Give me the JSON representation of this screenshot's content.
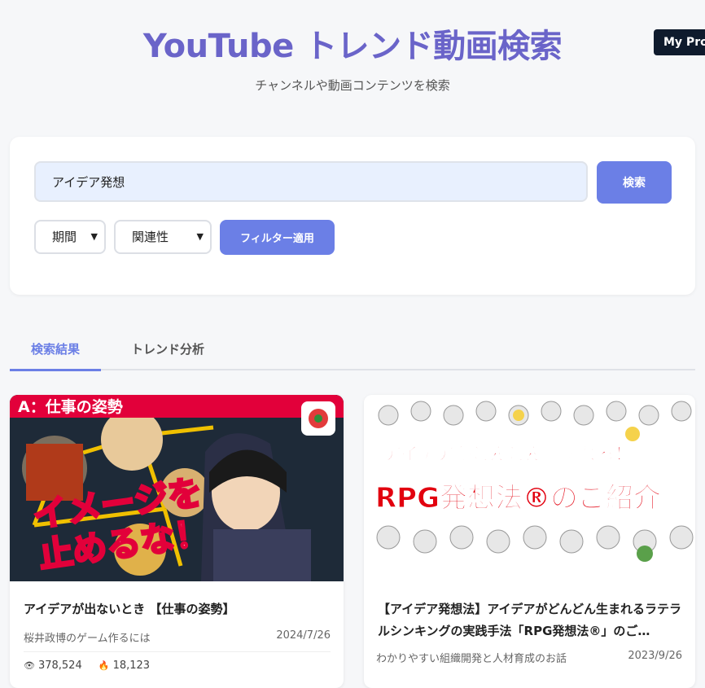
{
  "header": {
    "title": "YouTube トレンド動画検索",
    "subtitle": "チャンネルや動画コンテンツを検索",
    "profile_badge": "My Profile"
  },
  "search": {
    "query": "アイデア発想",
    "button_label": "検索",
    "period_select": "期間",
    "sort_select": "関連性",
    "filter_button": "フィルター適用"
  },
  "tabs": [
    {
      "label": "検索結果",
      "active": true
    },
    {
      "label": "トレンド分析",
      "active": false
    }
  ],
  "colors": {
    "accent": "#6b7fe6",
    "title": "#6a64c9"
  },
  "results": [
    {
      "thumbnail_text_top": "A：仕事の姿勢",
      "thumbnail_text_main": [
        "イメージを",
        "止めるな！"
      ],
      "title": "アイデアが出ないとき 【仕事の姿勢】",
      "channel": "桜井政博のゲーム作るには",
      "date": "2024/7/26",
      "views": "378,524",
      "likes": "18,123",
      "view_icon": "eye-icon",
      "like_icon": "fire-icon"
    },
    {
      "thumbnail_text_top": "アイデアがどんどん生まれる！",
      "thumbnail_text_main": [
        "RPG発想法®のご紹介"
      ],
      "title": "【アイデア発想法】アイデアがどんどん生まれるラテラルシンキングの実践手法「RPG発想法®」のご…",
      "channel": "わかりやすい組織開発と人材育成のお話",
      "date": "2023/9/26"
    }
  ]
}
